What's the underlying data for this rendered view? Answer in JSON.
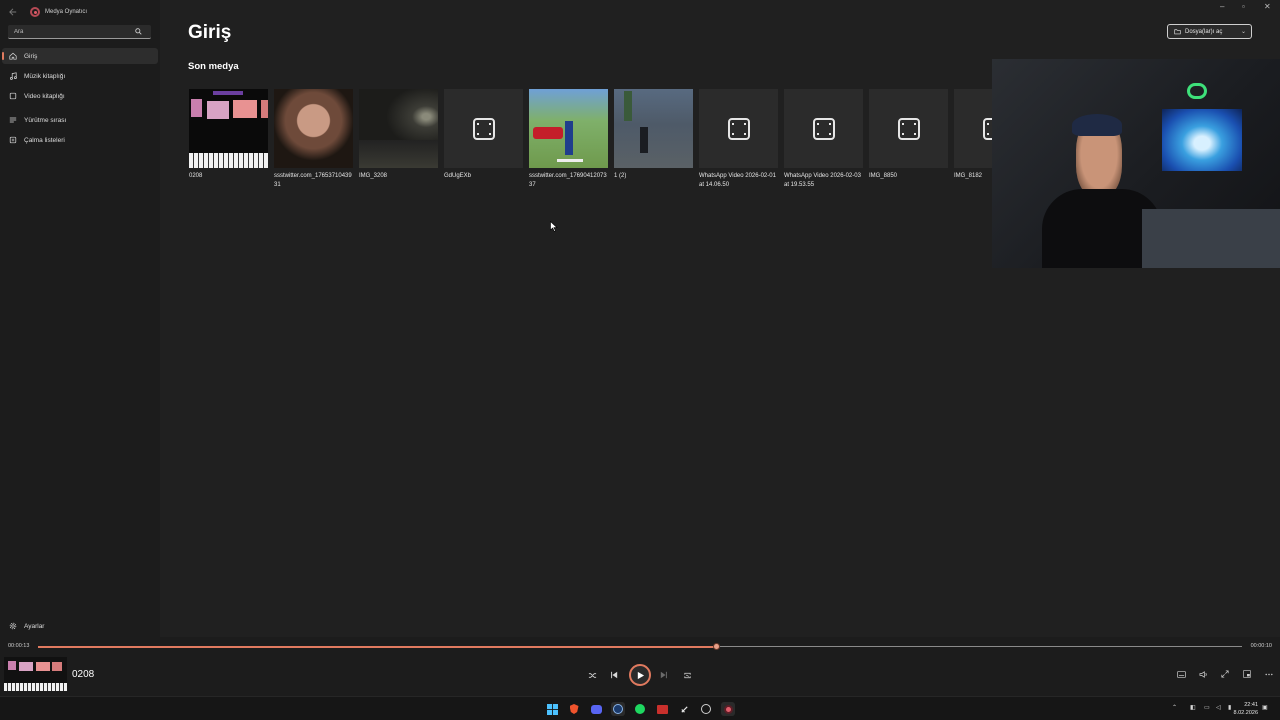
{
  "app": {
    "title": "Medya Oynatıcı"
  },
  "search": {
    "placeholder": "Ara"
  },
  "sidebar": {
    "items": [
      {
        "label": "Giriş",
        "icon": "home-icon",
        "active": true
      },
      {
        "label": "Müzik kitaplığı",
        "icon": "music-note-icon"
      },
      {
        "label": "Video kitaplığı",
        "icon": "video-icon"
      },
      {
        "label": "Yürütme sırası",
        "icon": "queue-icon"
      },
      {
        "label": "Çalma listeleri",
        "icon": "playlist-icon"
      }
    ],
    "settings_label": "Ayarlar"
  },
  "main": {
    "title": "Giriş",
    "section_title": "Son medya",
    "open_files_label": "Dosya(lar)ı aç",
    "media": [
      {
        "label": "0208",
        "thumb": "piano"
      },
      {
        "label": "ssstwitter.com_1765371043931",
        "thumb": "face"
      },
      {
        "label": "IMG_3208",
        "thumb": "road"
      },
      {
        "label": "GdUgEXb",
        "thumb": "none"
      },
      {
        "label": "ssstwitter.com_1769041207337",
        "thumb": "game"
      },
      {
        "label": "1 (2)",
        "thumb": "street"
      },
      {
        "label": "WhatsApp Video 2026-02-01 at 14.06.50",
        "thumb": "none"
      },
      {
        "label": "WhatsApp Video 2026-02-03 at 19.53.55",
        "thumb": "none"
      },
      {
        "label": "IMG_8850",
        "thumb": "none"
      },
      {
        "label": "IMG_8182",
        "thumb": "none"
      }
    ]
  },
  "player": {
    "now_playing": "0208",
    "time_current": "00:00:13",
    "time_total": "00:00:10",
    "progress": 0.563
  },
  "taskbar": {
    "time": "22:41",
    "date": "8.02.2026"
  },
  "colors": {
    "accent": "#e07a5f",
    "background": "#202020",
    "sidebar": "#1c1c1c"
  }
}
